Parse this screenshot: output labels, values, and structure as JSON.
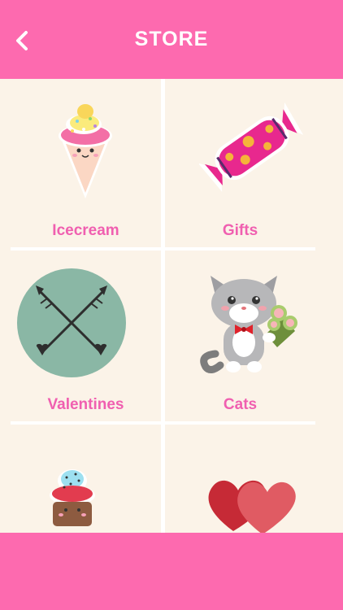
{
  "header": {
    "title": "STORE",
    "back_icon": "chevron-left-icon",
    "background": "#fd6aaf"
  },
  "store": {
    "items": [
      {
        "label": "Icecream",
        "icon": "icecream-icon"
      },
      {
        "label": "Gifts",
        "icon": "candy-icon"
      },
      {
        "label": "Valentines",
        "icon": "crossed-arrows-icon"
      },
      {
        "label": "Cats",
        "icon": "cat-icon"
      },
      {
        "label": "",
        "icon": "cupcake-icon"
      },
      {
        "label": "",
        "icon": "hearts-icon"
      }
    ]
  },
  "colors": {
    "accent": "#fd6aaf",
    "label": "#f05fb0",
    "background": "#fbf3e8",
    "divider": "#ffffff"
  }
}
